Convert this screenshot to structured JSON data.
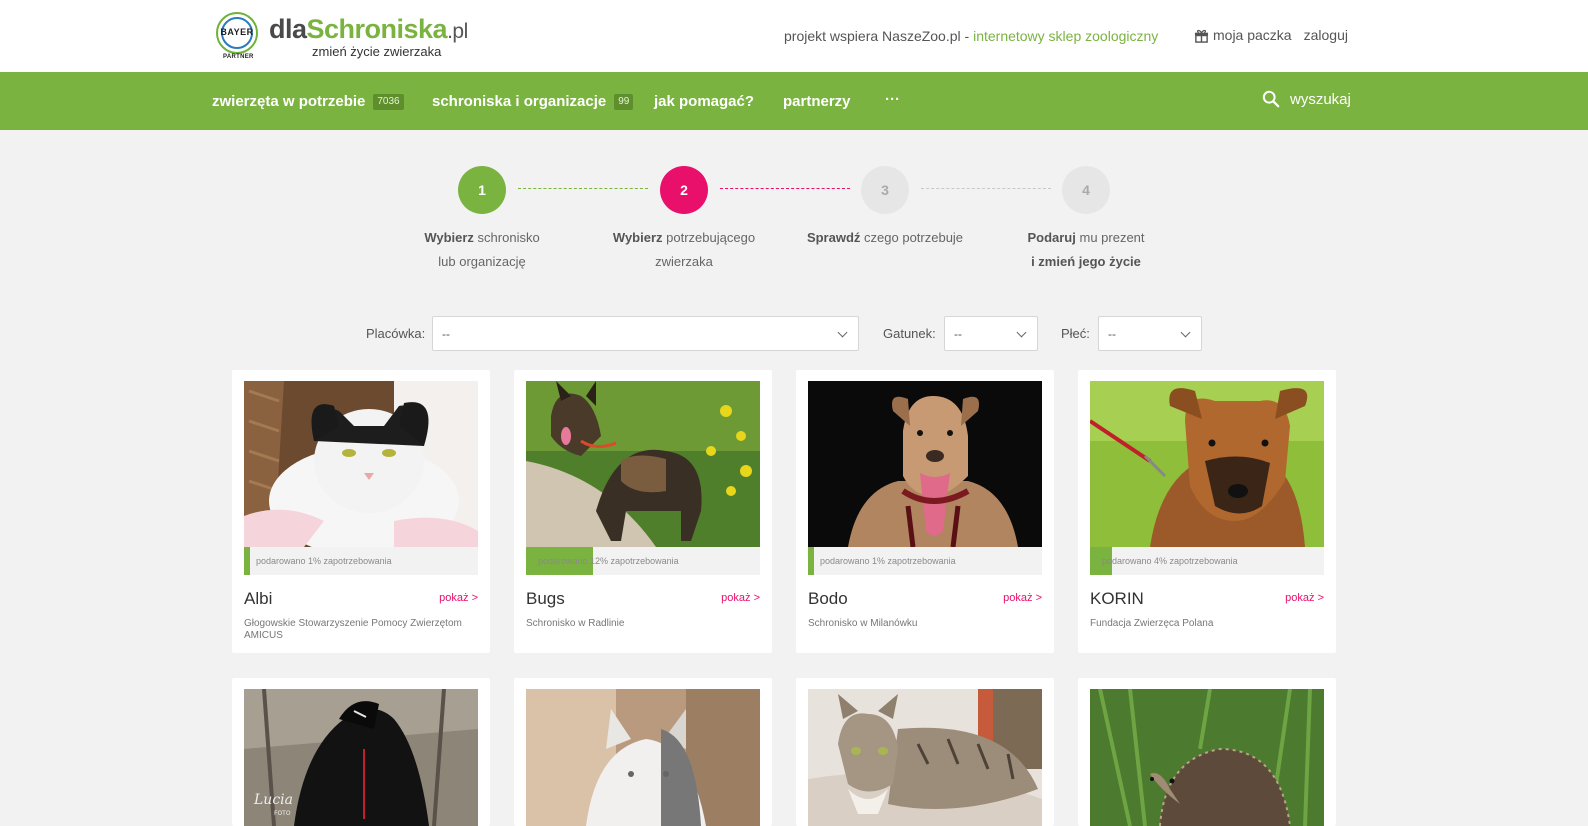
{
  "header": {
    "logo": {
      "bayer_text": "BAYER",
      "partner_text": "PARTNER",
      "brand_prefix": "dla",
      "brand_name": "Schroniska",
      "brand_suffix": ".pl",
      "tagline": "zmień życie zwierzaka"
    },
    "promo_text": "projekt wspiera NaszeZoo.pl -",
    "promo_link": "internetowy sklep zoologiczny",
    "cart_label": "moja paczka",
    "login_label": "zaloguj"
  },
  "nav": {
    "items": [
      {
        "label": "zwierzęta w potrzebie",
        "badge": "7036"
      },
      {
        "label": "schroniska i organizacje",
        "badge": "99"
      },
      {
        "label": "jak pomagać?"
      },
      {
        "label": "partnerzy"
      },
      {
        "label": "···"
      }
    ],
    "search_label": "wyszukaj"
  },
  "steps": [
    {
      "number": "1",
      "bold": "Wybierz",
      "text": "schronisko",
      "line2": "lub organizację",
      "state": "done"
    },
    {
      "number": "2",
      "bold": "Wybierz",
      "text": "potrzebującego",
      "line2": "zwierzaka",
      "state": "active"
    },
    {
      "number": "3",
      "bold": "Sprawdź",
      "text": "czego potrzebuje",
      "line2": "",
      "state": "todo"
    },
    {
      "number": "4",
      "bold": "Podaruj",
      "text": "mu prezent",
      "line2": "i zmień jego życie",
      "state": "todo"
    }
  ],
  "filters": {
    "placowka": {
      "label": "Placówka:",
      "value": "--"
    },
    "gatunek": {
      "label": "Gatunek:",
      "value": "--"
    },
    "plec": {
      "label": "Płeć:",
      "value": "--"
    }
  },
  "animals": [
    {
      "name": "Albi",
      "progress_text": "podarowano 1% zapotrzebowania",
      "progress": 0.01,
      "shelter": "Głogowskie Stowarzyszenie Pomocy Zwierzętom AMICUS",
      "show_label": "pokaż >"
    },
    {
      "name": "Bugs",
      "progress_text": "podarowano 12% zapotrzebowania",
      "progress": 0.12,
      "shelter": "Schronisko w Radlinie",
      "show_label": "pokaż >"
    },
    {
      "name": "Bodo",
      "progress_text": "podarowano 1% zapotrzebowania",
      "progress": 0.01,
      "shelter": "Schronisko w Milanówku",
      "show_label": "pokaż >"
    },
    {
      "name": "KORIN",
      "progress_text": "podarowano 4% zapotrzebowania",
      "progress": 0.04,
      "shelter": "Fundacja Zwierzęca Polana",
      "show_label": "pokaż >"
    },
    {
      "name": "",
      "progress_text": "",
      "progress": null,
      "shelter": "",
      "show_label": ""
    },
    {
      "name": "",
      "progress_text": "",
      "progress": null,
      "shelter": "",
      "show_label": ""
    },
    {
      "name": "",
      "progress_text": "",
      "progress": null,
      "shelter": "",
      "show_label": ""
    },
    {
      "name": "",
      "progress_text": "",
      "progress": null,
      "shelter": "",
      "show_label": ""
    }
  ],
  "colors": {
    "brand_green": "#7bb341",
    "accent_pink": "#e8106b"
  }
}
